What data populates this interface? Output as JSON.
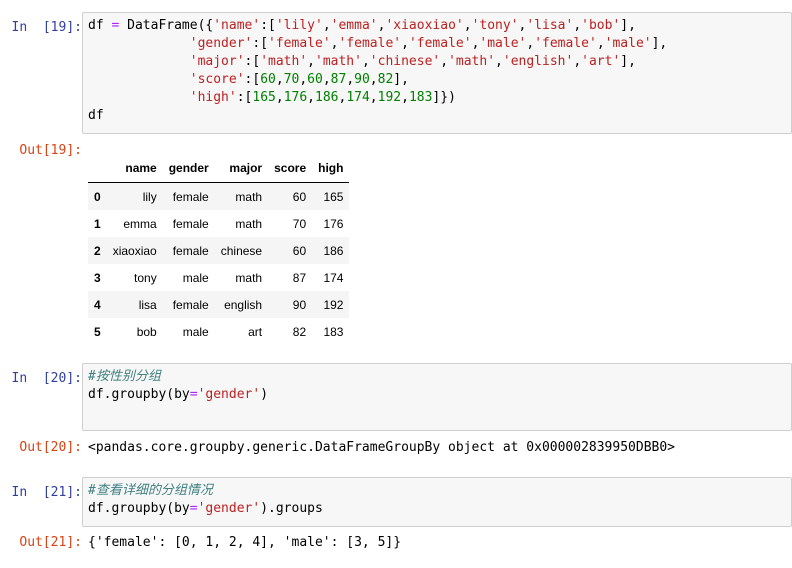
{
  "cells": {
    "c19": {
      "in_prompt": "In  [19]:",
      "out_prompt": "Out[19]:",
      "code_tail": "df"
    },
    "c20": {
      "in_prompt": "In  [20]:",
      "comment": "#按性别分组",
      "code_a": "df.groupby(by",
      "code_eq": "=",
      "code_str": "'gender'",
      "code_close": ")",
      "out_prompt": "Out[20]:",
      "output": "<pandas.core.groupby.generic.DataFrameGroupBy object at 0x000002839950DBB0>"
    },
    "c21": {
      "in_prompt": "In  [21]:",
      "comment": "#查看详细的分组情况",
      "code_a": "df.groupby(by",
      "code_eq": "=",
      "code_str": "'gender'",
      "code_close": ").groups",
      "out_prompt": "Out[21]:",
      "output": "{'female': [0, 1, 2, 4], 'male': [3, 5]}"
    }
  },
  "dataframe": {
    "columns": [
      "name",
      "gender",
      "major",
      "score",
      "high"
    ],
    "rows": [
      {
        "index": "0",
        "name": "lily",
        "gender": "female",
        "major": "math",
        "score": "60",
        "high": "165"
      },
      {
        "index": "1",
        "name": "emma",
        "gender": "female",
        "major": "math",
        "score": "70",
        "high": "176"
      },
      {
        "index": "2",
        "name": "xiaoxiao",
        "gender": "female",
        "major": "chinese",
        "score": "60",
        "high": "186"
      },
      {
        "index": "3",
        "name": "tony",
        "gender": "male",
        "major": "math",
        "score": "87",
        "high": "174"
      },
      {
        "index": "4",
        "name": "lisa",
        "gender": "female",
        "major": "english",
        "score": "90",
        "high": "192"
      },
      {
        "index": "5",
        "name": "bob",
        "gender": "male",
        "major": "art",
        "score": "82",
        "high": "183"
      }
    ]
  },
  "code19": {
    "l1_a": "df ",
    "l1_eq": "=",
    "l1_b": " DataFrame({",
    "l1_key": "'name'",
    "l1_c": ":[",
    "l1_v1": "'lily'",
    "l1_v2": "'emma'",
    "l1_v3": "'xiaoxiao'",
    "l1_v4": "'tony'",
    "l1_v5": "'lisa'",
    "l1_v6": "'bob'",
    "l1_end": "],",
    "l2_key": "'gender'",
    "l2_v1": "'female'",
    "l2_v2": "'female'",
    "l2_v3": "'female'",
    "l2_v4": "'male'",
    "l2_v5": "'female'",
    "l2_v6": "'male'",
    "l3_key": "'major'",
    "l3_v1": "'math'",
    "l3_v2": "'math'",
    "l3_v3": "'chinese'",
    "l3_v4": "'math'",
    "l3_v5": "'english'",
    "l3_v6": "'art'",
    "l4_key": "'score'",
    "l4_nums": [
      "60",
      "70",
      "60",
      "87",
      "90",
      "82"
    ],
    "l5_key": "'high'",
    "l5_nums": [
      "165",
      "176",
      "186",
      "174",
      "192",
      "183"
    ],
    "l5_end": "]})",
    "sep": ":[",
    "comma": ",",
    "close": "],"
  }
}
